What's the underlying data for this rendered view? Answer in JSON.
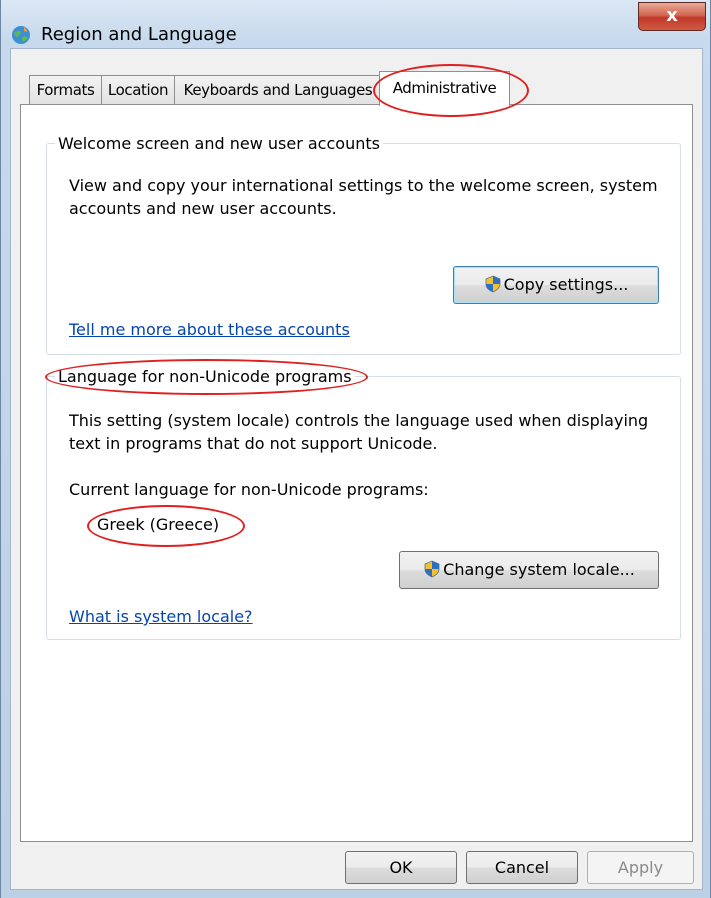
{
  "window": {
    "title": "Region and Language",
    "close_label": "x"
  },
  "tabs": [
    {
      "label": "Formats"
    },
    {
      "label": "Location"
    },
    {
      "label": "Keyboards and Languages"
    },
    {
      "label": "Administrative",
      "active": true
    }
  ],
  "welcome_group": {
    "legend": "Welcome screen and new user accounts",
    "description_line1": "View and copy your international settings to the welcome screen, system",
    "description_line2": "accounts and new user accounts.",
    "copy_button": "Copy settings...",
    "link": "Tell me more about these accounts"
  },
  "locale_group": {
    "legend": "Language for non-Unicode programs",
    "description_line1": "This setting (system locale) controls the language used when displaying",
    "description_line2": "text in programs that do not support Unicode.",
    "current_label": "Current language for non-Unicode programs:",
    "current_value": "Greek (Greece)",
    "change_button": "Change system locale...",
    "link": "What is system locale?"
  },
  "footer": {
    "ok": "OK",
    "cancel": "Cancel",
    "apply": "Apply"
  },
  "colors": {
    "annotation": "#e02020",
    "link": "#0645ad",
    "close": "#c0392b"
  }
}
